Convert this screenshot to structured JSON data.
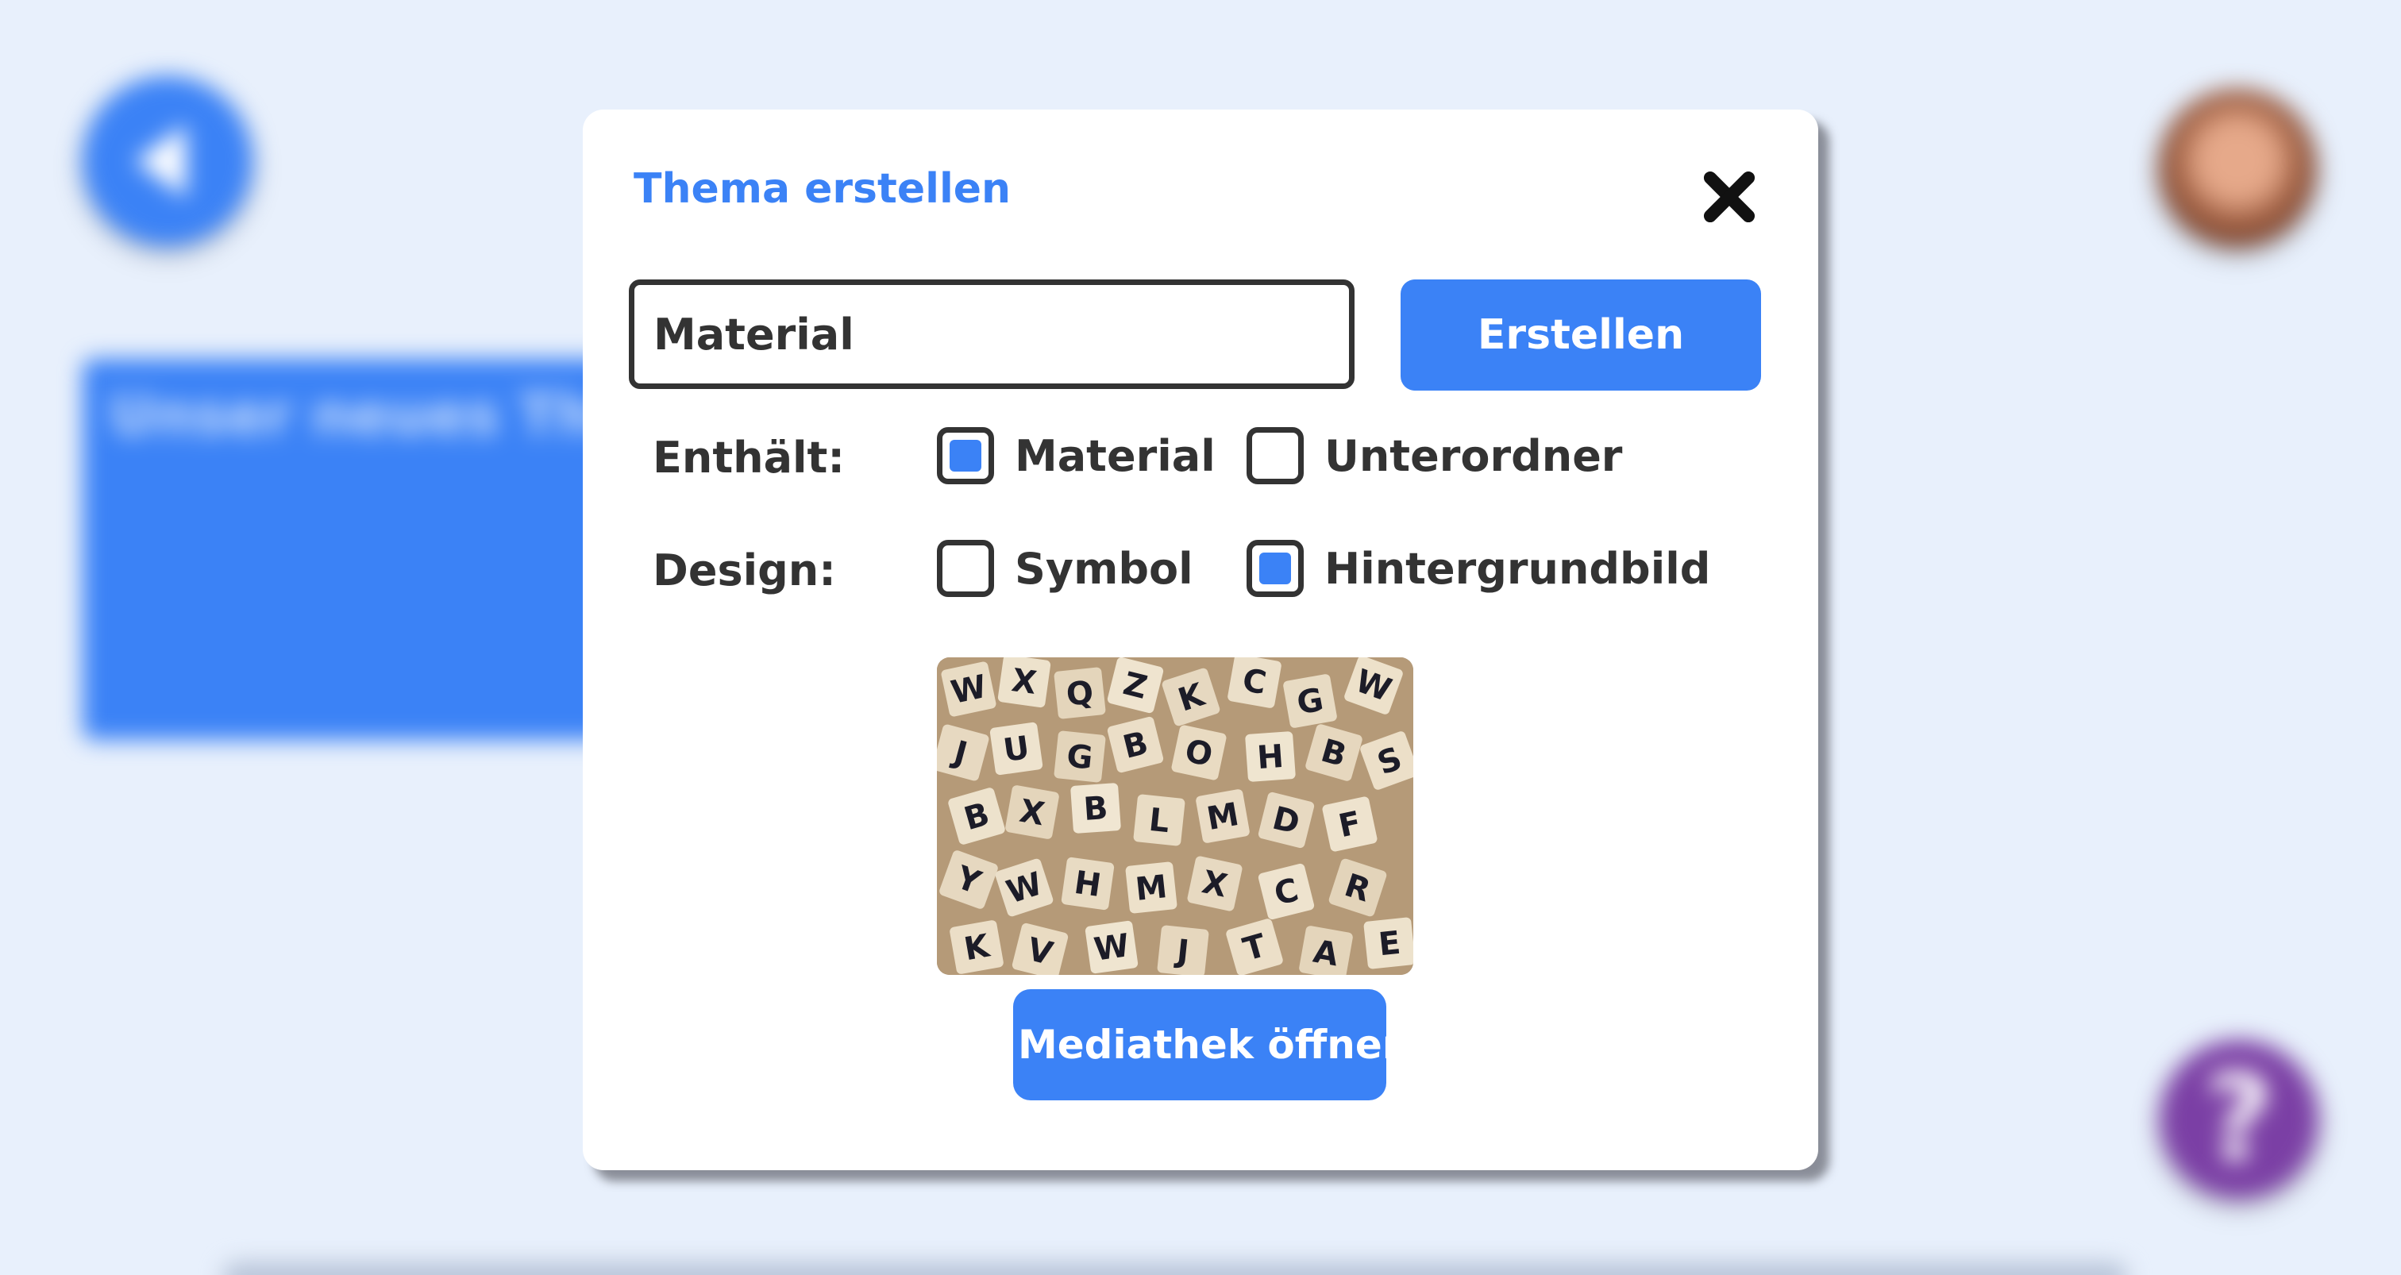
{
  "background": {
    "card_title": "Unser neues Thema"
  },
  "dialog": {
    "title": "Thema erstellen",
    "name_input": {
      "value": "Material"
    },
    "create_button_label": "Erstellen",
    "contains": {
      "label": "Enthält:",
      "options": [
        {
          "label": "Material",
          "checked": true
        },
        {
          "label": "Unterordner",
          "checked": false
        }
      ]
    },
    "design": {
      "label": "Design:",
      "options": [
        {
          "label": "Symbol",
          "checked": false
        },
        {
          "label": "Hintergrundbild",
          "checked": true
        }
      ]
    },
    "preview_image": "scattered wooden letter tiles",
    "media_button_label": "Mediathek öffnen"
  },
  "help_button_symbol": "?",
  "colors": {
    "accent": "#3b82f6",
    "background": "#e8f0fc",
    "text": "#333333",
    "help": "#7b3fa5"
  }
}
